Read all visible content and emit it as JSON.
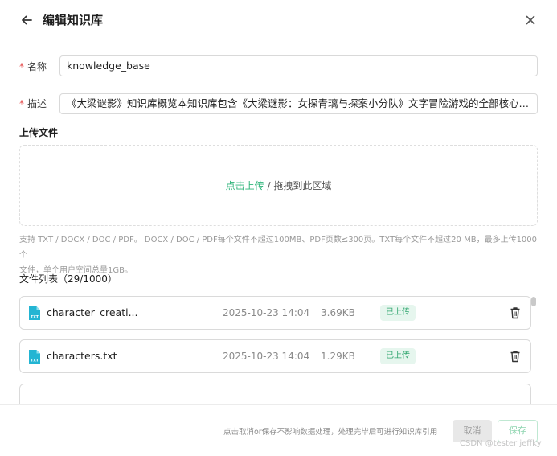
{
  "header": {
    "title": "编辑知识库",
    "back_icon": "arrow-left-icon",
    "close_icon": "close-x-icon"
  },
  "form": {
    "required_mark": "*",
    "name_label": "名称",
    "name_value": "knowledge_base",
    "desc_label": "描述",
    "desc_value": "《大梁谜影》知识库概览本知识库包含《大梁谜影：女探青璃与探案小分队》文字冒险游戏的全部核心信息，用于..."
  },
  "upload": {
    "section_title": "上传文件",
    "click_text": "点击上传",
    "drag_text": " / 拖拽到此区域",
    "hint_line1": "支持 TXT / DOCX / DOC / PDF。 DOCX / DOC / PDF每个文件不超过100MB、PDF页数≤300页。TXT每个文件不超过20 MB，最多上传1000个",
    "hint_line2": "文件，单个用户空间总量1GB。"
  },
  "file_list": {
    "title": "文件列表（29/1000）",
    "items": [
      {
        "name": "character_creati...",
        "date": "2025-10-23 14:04",
        "size": "3.69KB",
        "status": "已上传",
        "icon": "txt-file-icon"
      },
      {
        "name": "characters.txt",
        "date": "2025-10-23 14:04",
        "size": "1.29KB",
        "status": "已上传",
        "icon": "txt-file-icon"
      }
    ]
  },
  "footer": {
    "note": "点击取消or保存不影响数据处理，处理完毕后可进行知识库引用",
    "cancel_label": "取消",
    "save_label": "保存",
    "watermark": "CSDN @tester jeffky"
  },
  "colors": {
    "accent": "#2fb57a",
    "required": "#e54b4b",
    "status_bg": "#e6f6ee",
    "status_text": "#2fa56e",
    "file_icon": "#23b5d3"
  }
}
